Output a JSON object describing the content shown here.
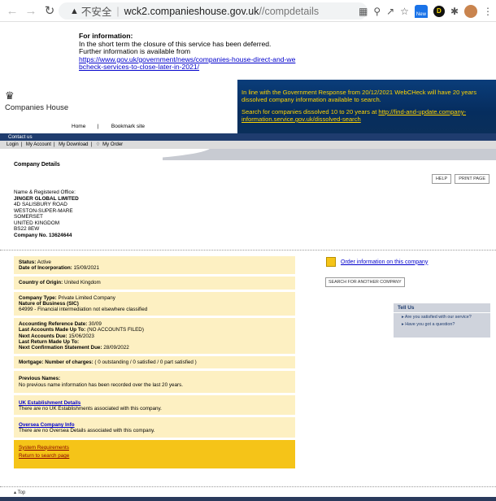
{
  "browser": {
    "insecure_label": "不安全",
    "domain": "wck2.companieshouse.gov.uk",
    "path": "//compdetails",
    "new_badge": "New"
  },
  "notice": {
    "title": "For information:",
    "line1": "In the short term the closure of this service has been deferred.",
    "line2": "Further information is available from",
    "link": "https://www.gov.uk/government/news/companies-house-direct-and-webcheck-services-to-close-later-in-2021/"
  },
  "header": {
    "logo_text": "Companies House",
    "home": "Home",
    "separator": "|",
    "bookmark": "Bookmark site",
    "message1": "In line with the Government Response from 20/12/2021 WebCHeck will have 20 years dissolved company information available to search.",
    "message2_prefix": "Search for companies dissolved 10 to 20 years at ",
    "message2_link": "http://find-and-update.company-information.service.gov.uk/dissolved-search"
  },
  "contact_bar": "Contact us",
  "toolbar": {
    "login": "Login",
    "my_account": "My Account",
    "my_download": "My Download",
    "my_order": "My Order",
    "sep": "|"
  },
  "subtitle": "Company Details",
  "buttons": {
    "help": "HELP",
    "print": "PRINT PAGE"
  },
  "reg_office": {
    "label": "Name & Registered Office:",
    "name": "JINGER GLOBAL LIMITED",
    "addr1": "4D SALISBURY ROAD",
    "addr2": "WESTON-SUPER-MARE",
    "addr3": "SOMERSET",
    "addr4": "UNITED KINGDOM",
    "addr5": "BS22 8EW",
    "company_no": "Company No. 13624644"
  },
  "status": {
    "status_label": "Status:",
    "status_value": "Active",
    "incorp_label": "Date of Incorporation:",
    "incorp_value": "15/09/2021",
    "country_label": "Country of Origin:",
    "country_value": "United Kingdom",
    "type_label": "Company Type:",
    "type_value": "Private Limited Company",
    "nature_label": "Nature of Business (SIC)",
    "nature_value": "64999 - Financial intermediation not elsewhere classified",
    "ard_label": "Accounting Reference Date:",
    "ard_value": "30/09",
    "lamu_label": "Last Accounts Made Up To:",
    "lamu_value": "(NO ACCOUNTS FILED)",
    "nad_label": "Next Accounts Due:",
    "nad_value": "15/06/2023",
    "lrmu_label": "Last Return Made Up To:",
    "ncsd_label": "Next Confirmation Statement Due:",
    "ncsd_value": "28/09/2022",
    "mortgage_label": "Mortgage:",
    "mortgage_charges_label": "Number of charges:",
    "mortgage_value": "( 0 outstanding / 0 satisfied / 0 part satisfied )",
    "prev_label": "Previous Names:",
    "prev_value": "No previous name information has been recorded over the last 20 years.",
    "uk_link": "UK Establishment Details",
    "uk_value": "There are no UK Establishments associated with this company.",
    "os_link": "Oversea Company Info",
    "os_value": "There are no Oversea Details associated with this company.",
    "sysreq": "System Requirements",
    "return": "Return to search page"
  },
  "right": {
    "order": "Order information on this company",
    "search_again": "SEARCH FOR ANOTHER COMPANY",
    "tellus": "Tell Us",
    "q1": "Are you satisfied with our service?",
    "q2": "Have you got a question?"
  },
  "footer": {
    "top": "Top"
  },
  "colors": {
    "accent_blue": "#062d5e",
    "accent_yellow": "#ffd400",
    "panel": "#fdf0c2",
    "gold": "#f5c418"
  }
}
